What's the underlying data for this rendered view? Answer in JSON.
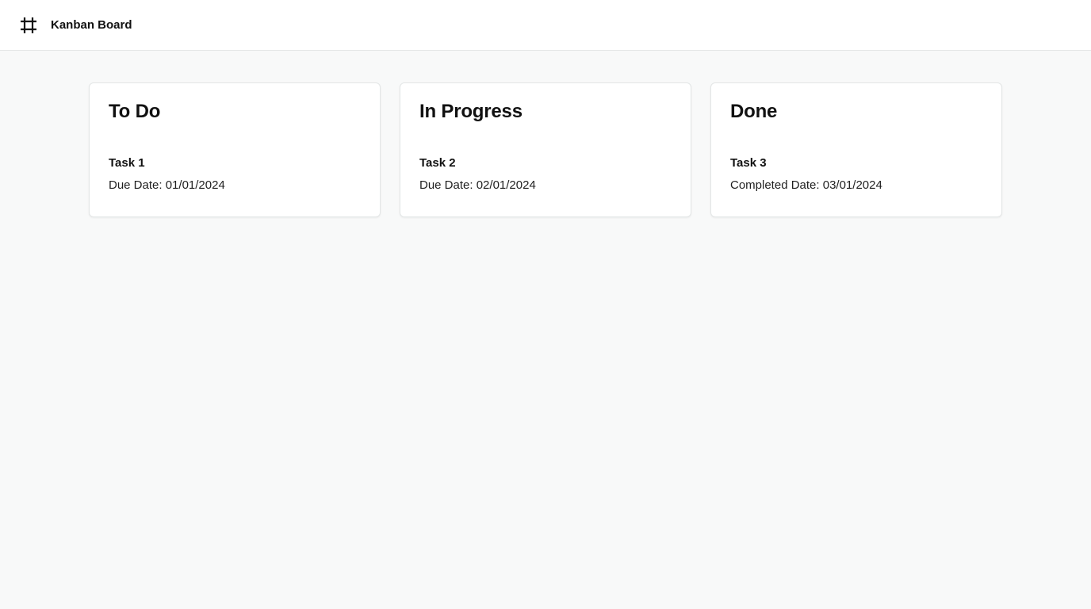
{
  "header": {
    "icon": "hashtag-grid-icon",
    "title": "Kanban Board"
  },
  "columns": [
    {
      "title": "To Do",
      "task": {
        "title": "Task 1",
        "meta_label": "Due Date:",
        "meta_value": "01/01/2024"
      }
    },
    {
      "title": "In Progress",
      "task": {
        "title": "Task 2",
        "meta_label": "Due Date:",
        "meta_value": "02/01/2024"
      }
    },
    {
      "title": "Done",
      "task": {
        "title": "Task 3",
        "meta_label": "Completed Date:",
        "meta_value": "03/01/2024"
      }
    }
  ],
  "colors": {
    "page_background": "#f8f9f9",
    "card_background": "#ffffff",
    "text": "#111111"
  }
}
